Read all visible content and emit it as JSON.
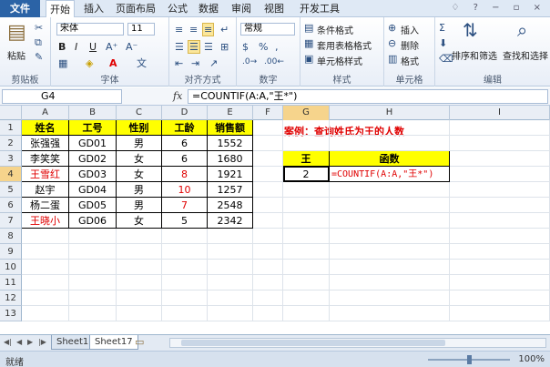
{
  "ribbon": {
    "tabs": [
      "文件",
      "开始",
      "插入",
      "页面布局",
      "公式",
      "数据",
      "审阅",
      "视图",
      "开发工具"
    ],
    "paste_label": "粘贴",
    "font_name": "宋体",
    "font_size": "11",
    "number_format": "常规",
    "styles": [
      "条件格式",
      "套用表格格式",
      "单元格样式"
    ],
    "cells": [
      "插入",
      "删除",
      "格式"
    ],
    "edit": [
      "排序和筛选",
      "查找和选择"
    ],
    "group_labels": [
      "剪贴板",
      "字体",
      "对齐方式",
      "数字",
      "样式",
      "单元格",
      "编辑"
    ]
  },
  "formula_bar": {
    "name_box": "G4",
    "fx": "fx",
    "formula": "=COUNTIF(A:A,\"王*\")"
  },
  "grid": {
    "columns": [
      "A",
      "B",
      "C",
      "D",
      "E",
      "F",
      "G",
      "H",
      "I"
    ],
    "rows": [
      "1",
      "2",
      "3",
      "4",
      "5",
      "6",
      "7",
      "8",
      "9",
      "10",
      "11",
      "12",
      "13"
    ],
    "table": {
      "headers": [
        "姓名",
        "工号",
        "性别",
        "工龄",
        "销售额"
      ],
      "rows": [
        [
          "张强强",
          "GD01",
          "男",
          "6",
          "1552"
        ],
        [
          "李笑笑",
          "GD02",
          "女",
          "6",
          "1680"
        ],
        [
          "王雪红",
          "GD03",
          "女",
          "8",
          "1921"
        ],
        [
          "赵宇",
          "GD04",
          "男",
          "10",
          "1257"
        ],
        [
          "杨二蛋",
          "GD05",
          "男",
          "7",
          "2548"
        ],
        [
          "王晓小",
          "GD06",
          "女",
          "5",
          "2342"
        ]
      ]
    },
    "case_title": "案例：查询姓氏为王的人数",
    "query": {
      "headers": [
        "王",
        "函数"
      ],
      "result": "2",
      "formula_text": "=COUNTIF(A:A,\"王*\")"
    }
  },
  "sheets": [
    "Sheet1",
    "Sheet17"
  ],
  "status": {
    "ready": "就绪",
    "zoom": "100%"
  },
  "colors": {
    "accent": "#2b63a6",
    "header_fill": "#ffff00",
    "highlight": "#e00000"
  }
}
